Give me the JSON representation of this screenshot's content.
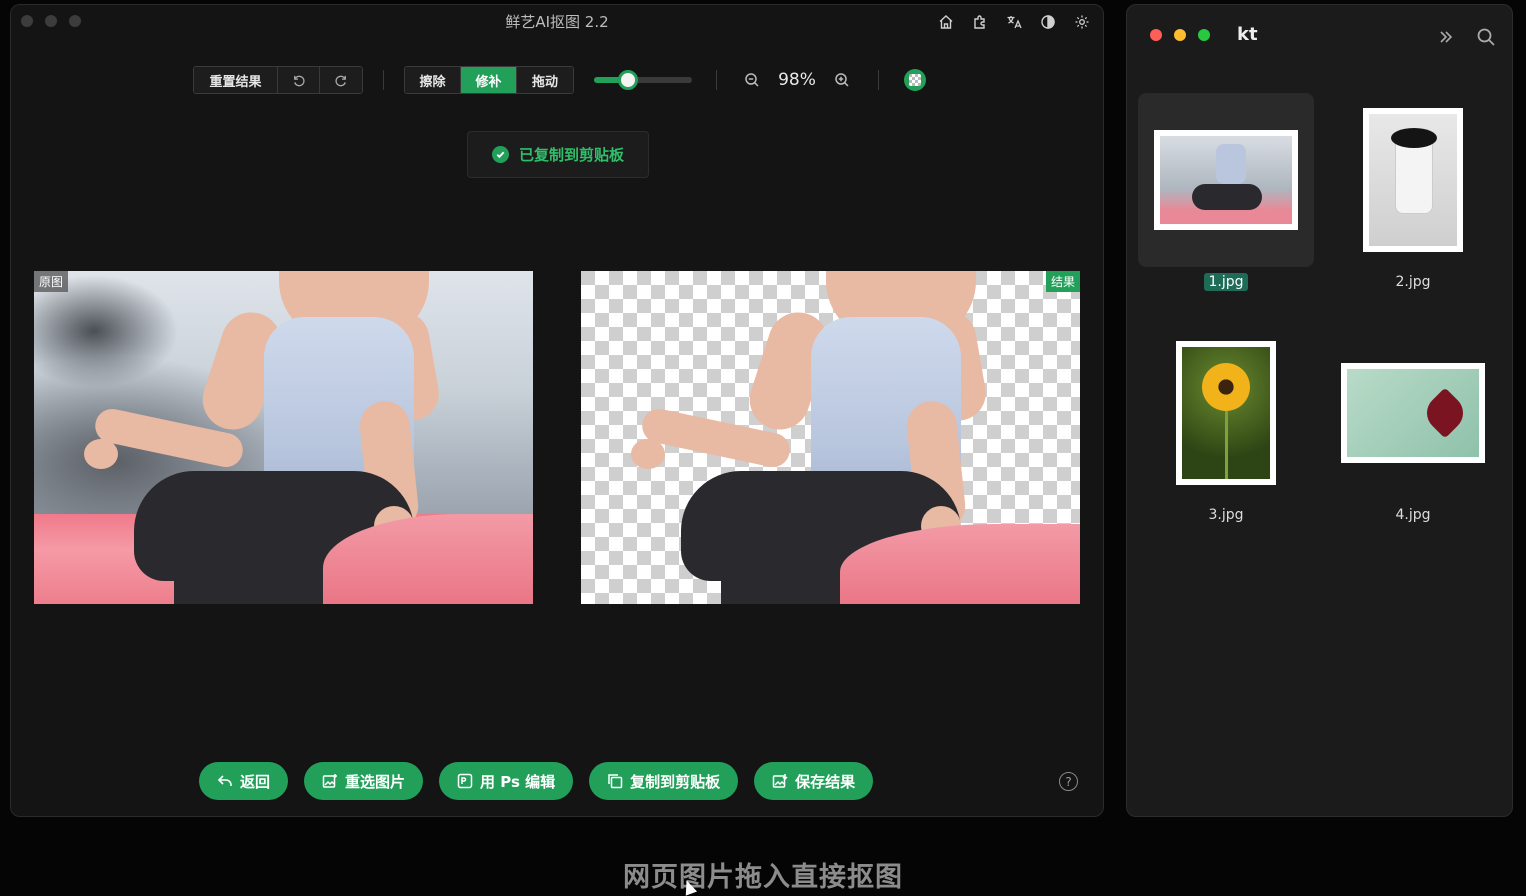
{
  "app": {
    "title": "鲜艺AI抠图 2.2"
  },
  "toolbar": {
    "reset_label": "重置结果",
    "modes": [
      "擦除",
      "修补",
      "拖动"
    ],
    "active_mode": "修补",
    "brush_size_fraction": 0.35,
    "zoom_label": "98%"
  },
  "toast": {
    "message": "已复制到剪贴板"
  },
  "panes": {
    "original_tag": "原图",
    "result_tag": "结果"
  },
  "actions": {
    "back": "返回",
    "reselect": "重选图片",
    "ps_edit": "用 Ps 编辑",
    "copy": "复制到剪贴板",
    "save": "保存结果"
  },
  "help_label": "?",
  "files": {
    "folder": "kt",
    "items": [
      {
        "name": "1.jpg",
        "selected": true
      },
      {
        "name": "2.jpg",
        "selected": false
      },
      {
        "name": "3.jpg",
        "selected": false
      },
      {
        "name": "4.jpg",
        "selected": false
      }
    ]
  },
  "caption": "网页图片拖入直接抠图",
  "colors": {
    "accent": "#22a05a",
    "window_bg": "#141414",
    "selection": "#1e6b56"
  }
}
